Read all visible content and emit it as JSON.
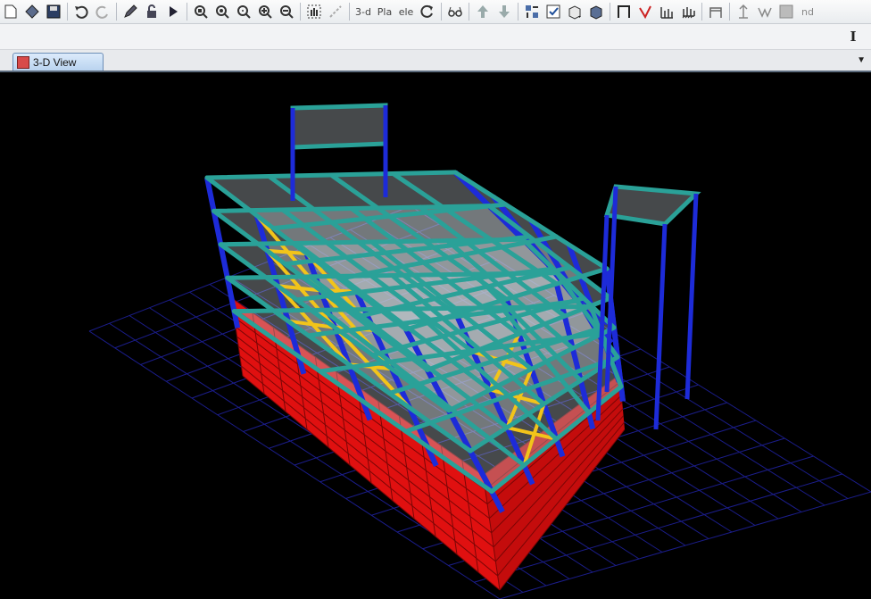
{
  "toolbar": {
    "icons": [
      "new-file-icon",
      "open-file-icon",
      "save-icon",
      "undo-icon",
      "redo-icon",
      "pencil-icon",
      "lock-icon",
      "run-icon",
      "zoom-window-icon",
      "zoom-in-icon",
      "zoom-out-icon",
      "zoom-plus-icon",
      "zoom-minus-icon",
      "pan-icon",
      "rubber-band-icon",
      "rotate-icon",
      "glasses-icon",
      "up-arrow-icon",
      "down-arrow-icon",
      "grid-snap-icon",
      "checkbox-icon",
      "box-icon",
      "cube-icon",
      "frame-icon",
      "check-mark-icon",
      "wall-icon",
      "ground-icon",
      "hinge-icon",
      "arrow-up-icon",
      "truss-icon",
      "hatch-icon"
    ],
    "view_3d_label": "3-d",
    "plan_label": "Pla",
    "elev_label": "ele",
    "last_label": "nd"
  },
  "strip": {
    "cursor_symbol": "I"
  },
  "tab": {
    "label": "3-D View"
  },
  "colors": {
    "background": "#000000",
    "beam": "#2aa198",
    "column": "#1d2bd8",
    "brace": "#f2c41a",
    "wall": "#e01010",
    "slab": "#c8d2d6",
    "grid": "#1b1d8a"
  }
}
